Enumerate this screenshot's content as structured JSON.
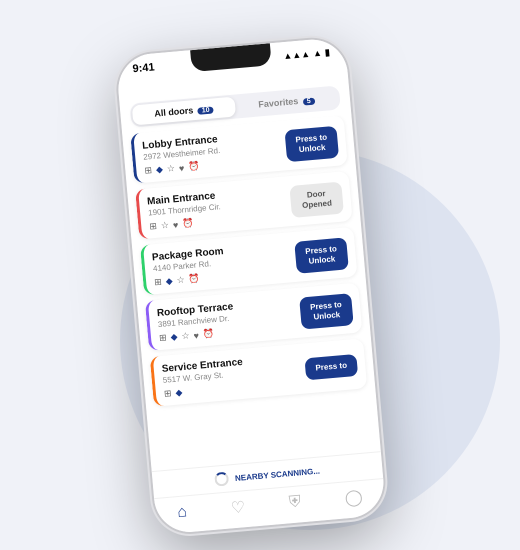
{
  "phone": {
    "status_bar": {
      "time": "9:41",
      "signal": "●●●",
      "wifi": "wifi",
      "battery": "battery"
    },
    "tabs": [
      {
        "label": "All doors",
        "badge": "10",
        "active": true
      },
      {
        "label": "Favorites",
        "badge": "5",
        "active": false
      }
    ],
    "doors": [
      {
        "name": "Lobby Entrance",
        "address": "2972 Westheimer Rd.",
        "border_color": "blue-border",
        "icons": [
          "qr",
          "bt",
          "wifi",
          "key",
          "time"
        ],
        "button_label": "Press to\nUnlock",
        "button_state": "unlock"
      },
      {
        "name": "Main Entrance",
        "address": "1901 Thornridge Cir.",
        "border_color": "red-border",
        "icons": [
          "qr",
          "wifi",
          "key",
          "time"
        ],
        "button_label": "Door\nOpened",
        "button_state": "opened"
      },
      {
        "name": "Package Room",
        "address": "4140 Parker Rd.",
        "border_color": "green-border",
        "icons": [
          "qr",
          "bt",
          "wifi",
          "time"
        ],
        "button_label": "Press to\nUnlock",
        "button_state": "unlock"
      },
      {
        "name": "Rooftop Terrace",
        "address": "3891 Ranchview Dr.",
        "border_color": "purple-border",
        "icons": [
          "qr",
          "bt",
          "wifi",
          "key",
          "time"
        ],
        "button_label": "Press to\nUnlock",
        "button_state": "unlock"
      },
      {
        "name": "Service Entrance",
        "address": "5517 W. Gray St.",
        "border_color": "orange-border",
        "icons": [
          "qr",
          "bt"
        ],
        "button_label": "Press to",
        "button_state": "unlock",
        "partial": true
      }
    ],
    "scanning_label": "NEARBY SCANNING...",
    "nav_icons": [
      "home",
      "heart",
      "shield",
      "person"
    ]
  }
}
